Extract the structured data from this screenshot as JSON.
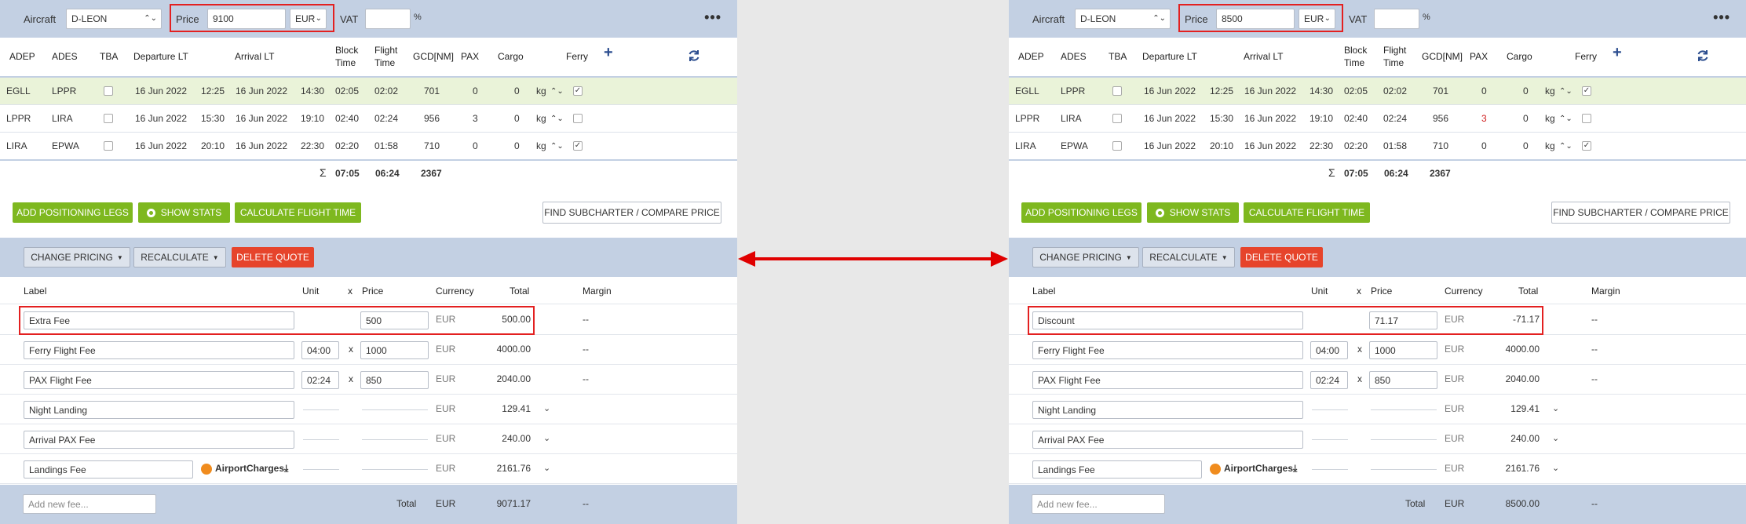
{
  "header": {
    "aircraft_label": "Aircraft",
    "aircraft_value": "D-LEON",
    "price_label": "Price",
    "currency": "EUR",
    "vat_label": "VAT",
    "vat_unit": "%",
    "more_icon": "more-horizontal-icon"
  },
  "legs_table": {
    "columns": [
      "ADEP",
      "ADES",
      "TBA",
      "Departure LT",
      "Arrival LT",
      "Block",
      "Time",
      "Flight",
      "Time",
      "GCD[NM]",
      "PAX",
      "Cargo",
      "Ferry"
    ],
    "add_icon": "plus-icon",
    "refresh_icon": "refresh-icon",
    "rows": [
      {
        "adep": "EGLL",
        "ades": "LPPR",
        "dep_date": "16 Jun 2022",
        "dep_time": "12:25",
        "arr_date": "16 Jun 2022",
        "arr_time": "14:30",
        "block": "02:05",
        "flight": "02:02",
        "gcd": "701",
        "pax": "0",
        "cargo": "0",
        "cargo_unit": "kg",
        "ferry": true
      },
      {
        "adep": "LPPR",
        "ades": "LIRA",
        "dep_date": "16 Jun 2022",
        "dep_time": "15:30",
        "arr_date": "16 Jun 2022",
        "arr_time": "19:10",
        "block": "02:40",
        "flight": "02:24",
        "gcd": "956",
        "pax": "3",
        "cargo": "0",
        "cargo_unit": "kg",
        "ferry": false
      },
      {
        "adep": "LIRA",
        "ades": "EPWA",
        "dep_date": "16 Jun 2022",
        "dep_time": "20:10",
        "arr_date": "16 Jun 2022",
        "arr_time": "22:30",
        "block": "02:20",
        "flight": "01:58",
        "gcd": "710",
        "pax": "0",
        "cargo": "0",
        "cargo_unit": "kg",
        "ferry": true
      }
    ],
    "totals": {
      "sigma": "Σ",
      "block": "07:05",
      "flight": "06:24",
      "gcd": "2367"
    }
  },
  "actions": {
    "add_positioning": "ADD POSITIONING LEGS",
    "show_stats": "SHOW STATS",
    "calculate": "CALCULATE FLIGHT TIME",
    "find_subcharter": "FIND SUBCHARTER / COMPARE PRICE"
  },
  "pricing_toolbar": {
    "change_pricing": "CHANGE PRICING",
    "recalculate": "RECALCULATE",
    "delete_quote": "DELETE QUOTE"
  },
  "pricing_table": {
    "columns": [
      "Label",
      "Unit",
      "x",
      "Price",
      "Currency",
      "Total",
      "Margin"
    ],
    "rows": [
      {
        "label": "Ferry Flight Fee",
        "unit": "04:00",
        "x": "x",
        "price": "1000",
        "currency": "EUR",
        "total": "4000.00",
        "margin": "--"
      },
      {
        "label": "PAX Flight Fee",
        "unit": "02:24",
        "x": "x",
        "price": "850",
        "currency": "EUR",
        "total": "2040.00",
        "margin": "--"
      },
      {
        "label": "Night Landing",
        "currency": "EUR",
        "total": "129.41"
      },
      {
        "label": "Arrival PAX Fee",
        "currency": "EUR",
        "total": "240.00"
      },
      {
        "label": "Landings Fee",
        "currency": "EUR",
        "total": "2161.76",
        "provider": "AirportCharges"
      }
    ],
    "add_placeholder": "Add new fee...",
    "total_label": "Total",
    "total_currency": "EUR",
    "margin_dash": "--"
  },
  "left": {
    "price": "9100",
    "first_fee": {
      "label": "Extra Fee",
      "price": "500",
      "currency": "EUR",
      "total": "500.00",
      "margin": "--"
    },
    "grand_total": "9071.17"
  },
  "right": {
    "price": "8500",
    "first_fee": {
      "label": "Discount",
      "price": "71.17",
      "currency": "EUR",
      "total": "-71.17",
      "margin": "--"
    },
    "grand_total": "8500.00"
  },
  "colors": {
    "header_bg": "#c3d0e3",
    "green": "#7eb81f",
    "red": "#e6442b",
    "highlight": "#e32020",
    "selected_row": "#eaf3d9",
    "pax_red": "#d02020"
  }
}
